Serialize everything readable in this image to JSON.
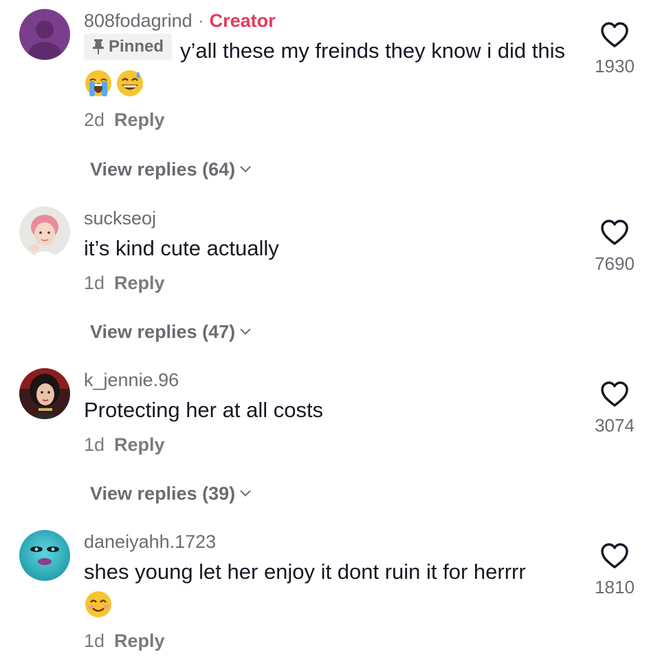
{
  "comments": [
    {
      "username": "808fodagrind",
      "creator_badge": "Creator",
      "pinned_label": "Pinned",
      "text": "y’all these my freinds they know i did this",
      "emojis": [
        "loudly-crying-face",
        "grinning-sweat-face"
      ],
      "time": "2d",
      "reply_label": "Reply",
      "view_replies": "View replies (64)",
      "likes": "1930",
      "avatar": "default-avatar"
    },
    {
      "username": "suckseoj",
      "text": "it’s kind cute actually",
      "time": "1d",
      "reply_label": "Reply",
      "view_replies": "View replies (47)",
      "likes": "7690",
      "avatar": "photo-avatar"
    },
    {
      "username": "k_jennie.96",
      "text": "Protecting her at all costs",
      "time": "1d",
      "reply_label": "Reply",
      "view_replies": "View replies (39)",
      "likes": "3074",
      "avatar": "photo-avatar"
    },
    {
      "username": "daneiyahh.1723",
      "text": "shes young let her enjoy it dont ruin it for herrrr",
      "emojis": [
        "smiling-face"
      ],
      "time": "1d",
      "reply_label": "Reply",
      "likes": "1810",
      "avatar": "photo-avatar"
    }
  ],
  "colors": {
    "creator": "#e8395a",
    "muted": "#6b6b72",
    "text": "#161823"
  }
}
